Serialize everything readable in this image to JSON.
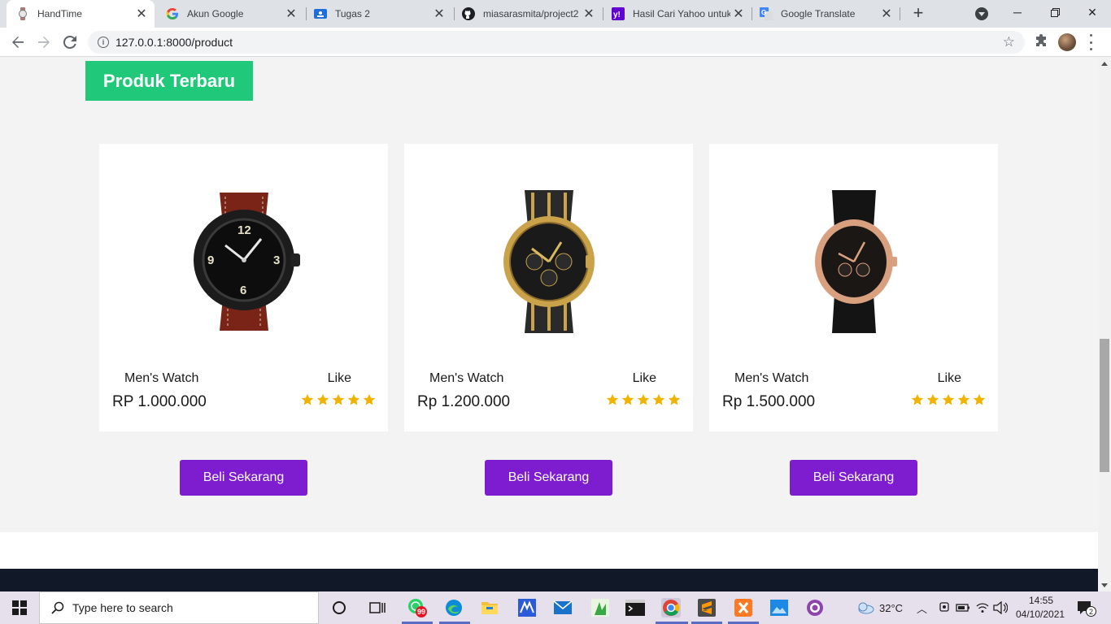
{
  "browser": {
    "tabs": [
      {
        "title": "HandTime",
        "active": true
      },
      {
        "title": "Akun Google",
        "active": false
      },
      {
        "title": "Tugas 2",
        "active": false
      },
      {
        "title": "miasarasmita/project2",
        "active": false
      },
      {
        "title": "Hasil Cari Yahoo untuk",
        "active": false
      },
      {
        "title": "Google Translate",
        "active": false
      }
    ],
    "url": "127.0.0.1:8000/product"
  },
  "page": {
    "heading": "Produk Terbaru",
    "products": [
      {
        "name": "Men's Watch",
        "like_label": "Like",
        "price": "RP 1.000.000",
        "rating": 5,
        "buy_label": "Beli Sekarang"
      },
      {
        "name": "Men's Watch",
        "like_label": "Like",
        "price": "Rp 1.200.000",
        "rating": 5,
        "buy_label": "Beli Sekarang"
      },
      {
        "name": "Men's Watch",
        "like_label": "Like",
        "price": "Rp 1.500.000",
        "rating": 5,
        "buy_label": "Beli Sekarang"
      }
    ],
    "colors": {
      "heading_bg": "#20c979",
      "button_bg": "#7e1ccf",
      "star": "#f0b400",
      "footer": "#111827"
    }
  },
  "taskbar": {
    "search_placeholder": "Type here to search",
    "whatsapp_badge": "99",
    "temperature": "32°C",
    "time": "14:55",
    "date": "04/10/2021",
    "notification_count": "2"
  }
}
